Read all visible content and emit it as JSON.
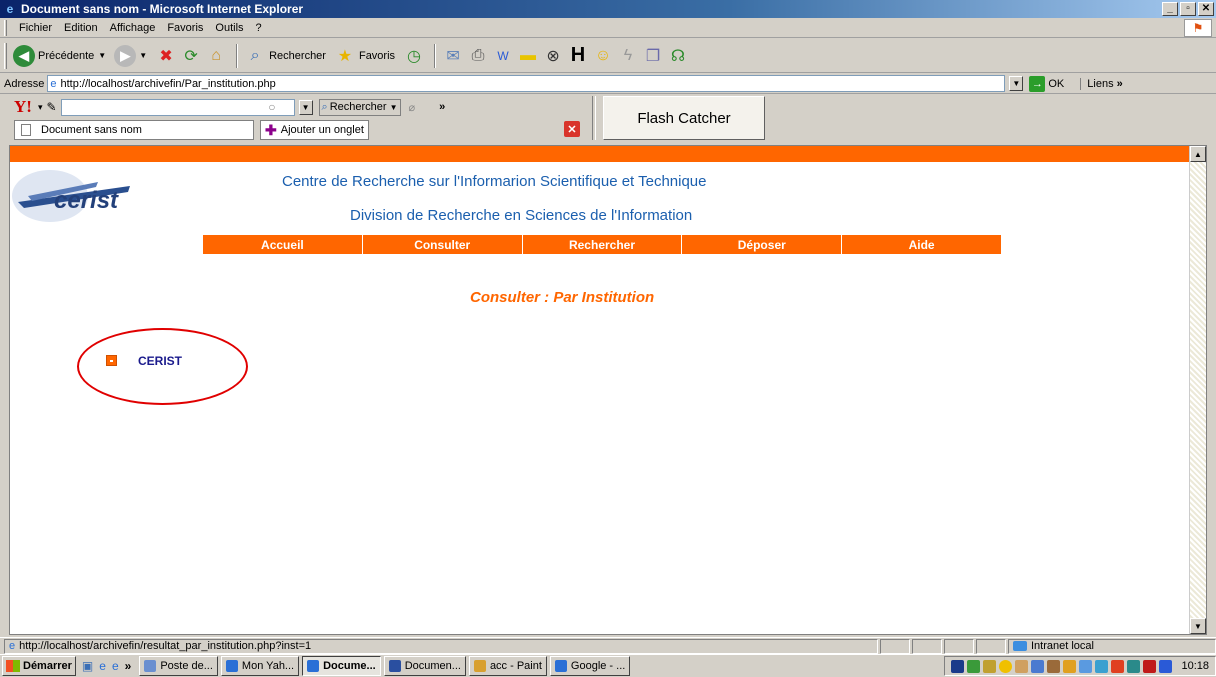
{
  "window": {
    "title": "Document sans nom - Microsoft Internet Explorer"
  },
  "menu": [
    "Fichier",
    "Edition",
    "Affichage",
    "Favoris",
    "Outils",
    "?"
  ],
  "toolbar": {
    "back_label": "Précédente",
    "search_label": "Rechercher",
    "favorites_label": "Favoris"
  },
  "address": {
    "label": "Adresse",
    "url": "http://localhost/archivefin/Par_institution.php",
    "go_label": "OK",
    "links_label": "Liens"
  },
  "yahoo": {
    "search_label": "Rechercher",
    "more_label": "»"
  },
  "flash_catcher": "Flash Catcher",
  "tabs": {
    "current": "Document sans nom",
    "add_label": "Ajouter un onglet"
  },
  "page": {
    "logo_text": "cerist",
    "heading1": "Centre de Recherche sur l'Informarion Scientifique et Technique",
    "heading2": "Division de Recherche en Sciences de l'Information",
    "nav": [
      "Accueil",
      "Consulter",
      "Rechercher",
      "Déposer",
      "Aide"
    ],
    "subtitle": "Consulter : Par Institution",
    "institution": "CERIST"
  },
  "status": {
    "text": "http://localhost/archivefin/resultat_par_institution.php?inst=1",
    "zone": "Intranet local"
  },
  "taskbar": {
    "start_label": "Démarrer",
    "tasks": [
      "Poste de...",
      "Mon Yah...",
      "Docume...",
      "Documen...",
      "acc - Paint",
      "Google - ..."
    ],
    "clock": "10:18"
  },
  "colors": {
    "accent": "#ff6600",
    "heading": "#1b5fae",
    "link": "#1a1a8c",
    "highlight_circle": "#e00000"
  }
}
